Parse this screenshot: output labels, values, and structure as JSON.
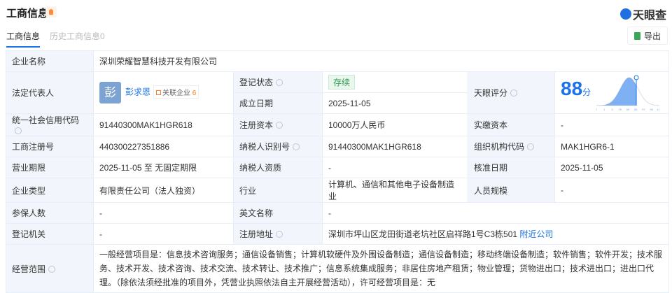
{
  "header": {
    "title": "工商信息",
    "brand": "天眼查",
    "export_label": "导出"
  },
  "tabs": [
    {
      "label": "工商信息"
    },
    {
      "label": "历史工商信息0"
    }
  ],
  "info": {
    "company_name_label": "企业名称",
    "company_name": "深圳荣耀智慧科技开发有限公司",
    "legal_rep_label": "法定代表人",
    "legal_rep_avatar": "彭",
    "legal_rep": "彭求恩",
    "related_label": "关联企业",
    "related_count": "6",
    "reg_status_label": "登记状态",
    "reg_status": "存续",
    "found_date_label": "成立日期",
    "found_date": "2025-11-05",
    "score_label": "天眼评分",
    "score": "88",
    "score_unit": "分",
    "credit_code_label": "统一社会信用代码",
    "credit_code": "91440300MAK1HGR618",
    "reg_capital_label": "注册资本",
    "reg_capital": "10000万人民币",
    "paid_capital_label": "实缴资本",
    "paid_capital": "-",
    "reg_no_label": "工商注册号",
    "reg_no": "440300227351886",
    "taxpayer_id_label": "纳税人识别号",
    "taxpayer_id": "91440300MAK1HGR618",
    "org_code_label": "组织机构代码",
    "org_code": "MAK1HGR6-1",
    "term_label": "营业期限",
    "term": "2025-11-05 至 无固定期限",
    "taxpayer_qual_label": "纳税人资质",
    "taxpayer_qual": "-",
    "approve_date_label": "核准日期",
    "approve_date": "2025-11-05",
    "type_label": "企业类型",
    "type": "有限责任公司（法人独资）",
    "industry_label": "行业",
    "industry": "计算机、通信和其他电子设备制造业",
    "staff_label": "人员规模",
    "staff": "-",
    "insured_label": "参保人数",
    "insured": "-",
    "en_name_label": "英文名称",
    "en_name": "-",
    "authority_label": "登记机关",
    "authority": "-",
    "address_label": "注册地址",
    "address": "深圳市坪山区龙田街道老坑社区启祥路1号C3栋501",
    "nearby_label": "附近公司",
    "scope_label": "经营范围",
    "scope": "一般经营项目是：信息技术咨询服务；通信设备销售；计算机软硬件及外围设备制造；通信设备制造；移动终端设备制造；软件销售；软件开发；技术服务、技术开发、技术咨询、技术交流、技术转让、技术推广；信息系统集成服务；非居住房地产租赁；物业管理；货物进出口；技术进出口；进出口代理。（除依法须经批准的项目外，凭营业执照依法自主开展经营活动），许可经营项目是：无"
  },
  "chart_data": {
    "type": "area",
    "title": "天眼评分分布",
    "x_ticks": [
      "0",
      "1",
      "3",
      "15",
      "50",
      "85",
      "97",
      "99",
      "100"
    ],
    "marker_value": 88,
    "colors": {
      "fill": "#4a8ef0",
      "marker": "#1a73e8"
    }
  }
}
